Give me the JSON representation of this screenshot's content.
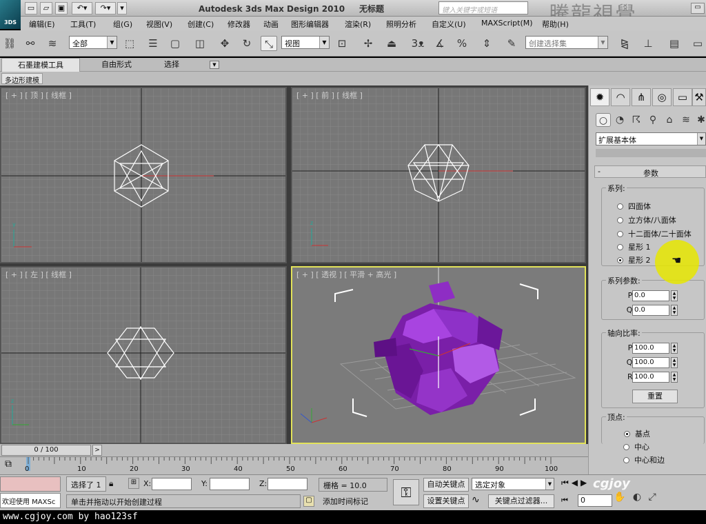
{
  "app": {
    "title": "Autodesk 3ds Max Design 2010",
    "doc_title": "无标题",
    "logo": "3DS"
  },
  "search": {
    "placeholder": "键入关键字或短语"
  },
  "watermark": "騰龍視覺",
  "menu": [
    "编辑(E)",
    "工具(T)",
    "组(G)",
    "视图(V)",
    "创建(C)",
    "修改器",
    "动画",
    "图形编辑器",
    "渲染(R)",
    "照明分析",
    "自定义(U)",
    "MAXScript(M)",
    "帮助(H)"
  ],
  "toolbar": {
    "filter_value": "全部",
    "ref_coord": "视图",
    "selection_set_placeholder": "创建选择集"
  },
  "ribbon": {
    "tabs": [
      "石墨建模工具",
      "自由形式",
      "选择"
    ],
    "sub": "多边形建模"
  },
  "viewports": {
    "top": "[ + ] [ 顶 ] [ 线框 ]",
    "front": "[ + ] [ 前 ] [ 线框 ]",
    "left": "[ + ] [ 左 ] [ 线框 ]",
    "persp": "[ + ] [ 透视 ] [ 平滑 + 高光 ]"
  },
  "cmd_panel": {
    "category": "扩展基本体",
    "rollout_title": "参数",
    "family": {
      "label": "系列:",
      "options": [
        "四面体",
        "立方体/八面体",
        "十二面体/二十面体",
        "星形 1",
        "星形 2"
      ],
      "selected": 4
    },
    "family_params": {
      "label": "系列参数:",
      "p": "0.0",
      "q": "0.0",
      "p_label": "P:",
      "q_label": "Q:"
    },
    "axis_scale": {
      "label": "轴向比率:",
      "p": "100.0",
      "q": "100.0",
      "r": "100.0",
      "p_label": "P:",
      "q_label": "Q:",
      "r_label": "R:",
      "reset": "重置"
    },
    "vertices": {
      "label": "顶点:",
      "options": [
        "基点",
        "中心",
        "中心和边"
      ],
      "selected": 0
    }
  },
  "timeline": {
    "frame": "0 / 100",
    "next": ">",
    "ticks": [
      "0",
      "10",
      "20",
      "30",
      "40",
      "50",
      "60",
      "70",
      "80",
      "90",
      "100"
    ]
  },
  "status": {
    "maxscript": "欢迎使用 MAXSc",
    "selected": "选择了 1",
    "x_label": "X:",
    "y_label": "Y:",
    "z_label": "Z:",
    "grid": "栅格 = 10.0",
    "prompt": "单击并拖动以开始创建过程",
    "add_time_tag": "添加时间标记",
    "auto_key": "自动关键点",
    "set_key": "设置关键点",
    "key_mode": "选定对象",
    "key_filters": "关键点过滤器...",
    "frame_value": "0"
  },
  "footer": {
    "credit": "www.cgjoy.com by hao123sf",
    "logo": "cgjoy"
  },
  "colors": {
    "accent_viewport": "#e3e35a",
    "object": "#8a24b8",
    "cursor": "#e6e600"
  }
}
